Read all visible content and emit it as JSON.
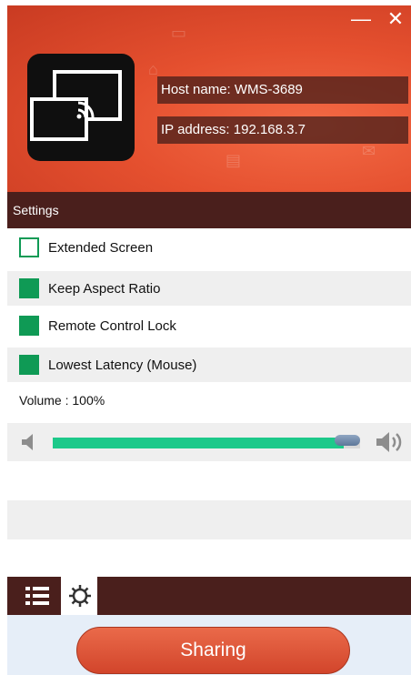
{
  "window": {
    "minimize_glyph": "—",
    "close_glyph": "✕"
  },
  "host": {
    "name": "Host name: WMS-3689",
    "ip": "IP address: 192.168.3.7"
  },
  "settings": {
    "title": "Settings",
    "options": [
      {
        "label": "Extended Screen",
        "checked": false
      },
      {
        "label": "Keep Aspect Ratio",
        "checked": true
      },
      {
        "label": "Remote Control Lock",
        "checked": true
      },
      {
        "label": "Lowest Latency  (Mouse)",
        "checked": true
      }
    ]
  },
  "volume": {
    "label": "Volume  : 100%",
    "level": 1.0
  },
  "tabs": [
    {
      "name": "list",
      "icon": "list-icon",
      "active": false
    },
    {
      "name": "settings",
      "icon": "gear-icon",
      "active": true
    }
  ],
  "footer": {
    "share_label": "Sharing"
  },
  "colors": {
    "accent_red": "#e5502f",
    "dark_bar": "#4a1f1c",
    "check_green": "#0f9a55",
    "volume_fill": "#1dc98a"
  }
}
